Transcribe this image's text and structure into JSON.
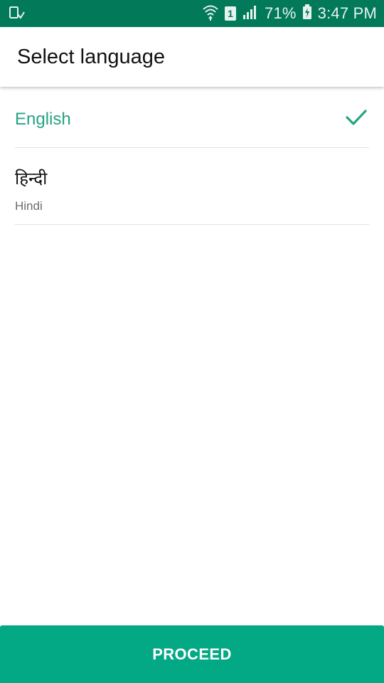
{
  "status_bar": {
    "battery": "71%",
    "time": "3:47 PM",
    "sim_slot": "1",
    "icons": [
      "download-icon",
      "wifi-icon",
      "sim-icon",
      "signal-icon",
      "battery-charging-icon"
    ]
  },
  "app_bar": {
    "title": "Select language"
  },
  "languages": [
    {
      "name": "English",
      "selected": true
    },
    {
      "native": "हिन्दी",
      "name": "Hindi",
      "selected": false
    }
  ],
  "proceed": {
    "label": "PROCEED"
  },
  "colors": {
    "status_bar": "#027a5a",
    "accent": "#26a383",
    "button": "#03a884"
  }
}
